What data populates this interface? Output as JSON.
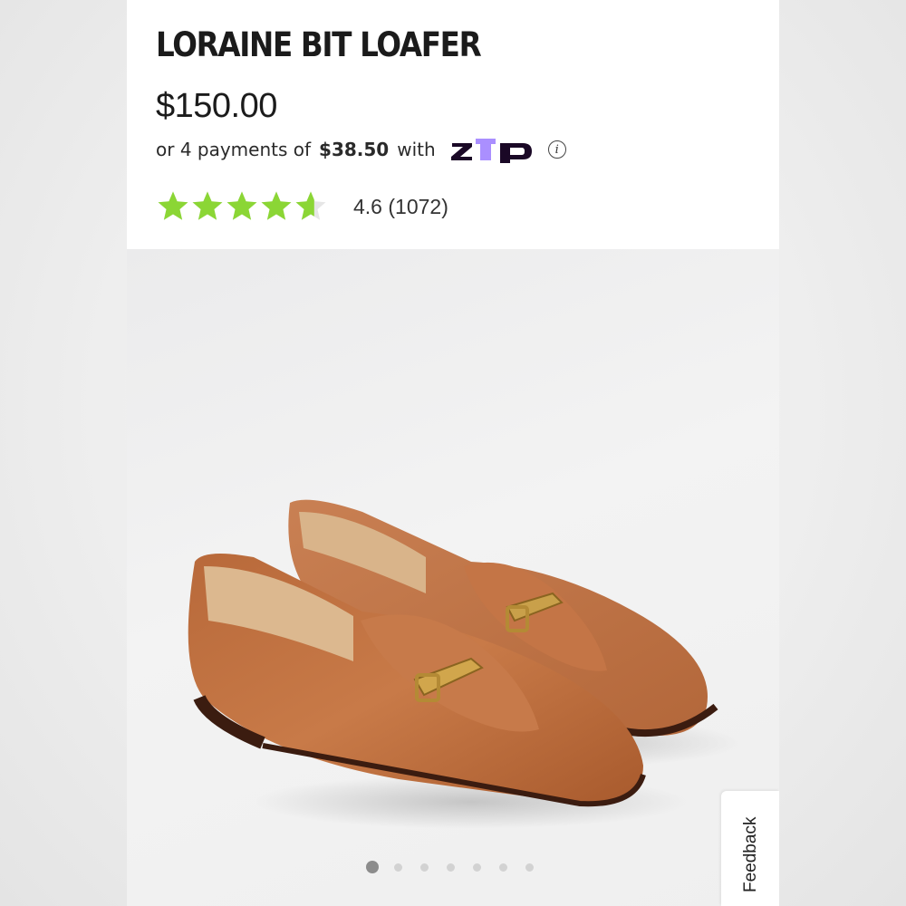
{
  "product": {
    "title": "LORAINE BIT LOAFER",
    "price": "$150.00"
  },
  "installments": {
    "prefix": "or 4 payments of",
    "amount": "$38.50",
    "suffix": "with",
    "provider_icon": "zip-logo",
    "info_icon": "info-icon"
  },
  "rating": {
    "value": 4.6,
    "max": 5,
    "text": "4.6 (1072)",
    "star_color": "#8bd635",
    "empty_color": "#e6e6e6"
  },
  "gallery": {
    "image_count": 7,
    "active_index": 0
  },
  "feedback": {
    "label": "Feedback"
  },
  "colors": {
    "zip_purple": "#aa8fff",
    "zip_dark": "#1a0826",
    "leather": "#c06b3a"
  }
}
